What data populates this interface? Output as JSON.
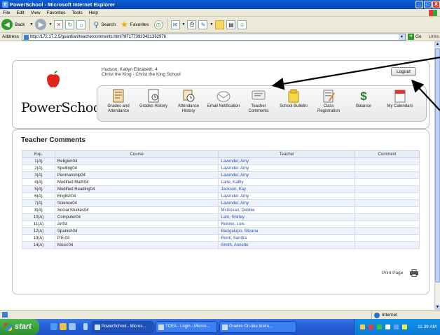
{
  "window": {
    "title": "PowerSchool - Microsoft Internet Explorer",
    "buttons": {
      "minimize": "_",
      "maximize": "□",
      "close": "X"
    }
  },
  "menu": [
    "File",
    "Edit",
    "View",
    "Favorites",
    "Tools",
    "Help"
  ],
  "toolbar": {
    "back": "Back",
    "search": "Search",
    "favorites": "Favorites"
  },
  "address": {
    "label": "Address",
    "url": "http://172.17.2.5/guardian/teachercomments.html?871773923421362976",
    "go": "Go",
    "links": "Links"
  },
  "header": {
    "logo": "PowerSchool",
    "student": "Hudson, Katlyn Elizabeth, 4",
    "school": "Christ the King - Christ the King School",
    "logout": "Logout"
  },
  "nav": [
    {
      "label": "Grades and Attendance",
      "icon": "grades-attendance-icon"
    },
    {
      "label": "Grades History",
      "icon": "grades-history-icon"
    },
    {
      "label": "Attendance History",
      "icon": "attendance-history-icon"
    },
    {
      "label": "Email Notification",
      "icon": "email-notification-icon"
    },
    {
      "label": "Teacher Comments",
      "icon": "teacher-comments-icon"
    },
    {
      "label": "School Bulletin",
      "icon": "school-bulletin-icon"
    },
    {
      "label": "Class Registration",
      "icon": "class-registration-icon"
    },
    {
      "label": "Balance",
      "icon": "balance-icon"
    },
    {
      "label": "My Calendars",
      "icon": "calendar-icon"
    }
  ],
  "content": {
    "title": "Teacher Comments",
    "columns": [
      "Exp.",
      "Course",
      "Teacher",
      "Comment"
    ],
    "rows": [
      {
        "exp": "1(A)",
        "course": "Religion04",
        "teacher": "Lavender, Amy",
        "comment": ""
      },
      {
        "exp": "2(A)",
        "course": "Spelling04",
        "teacher": "Lavender, Amy",
        "comment": ""
      },
      {
        "exp": "3(A)",
        "course": "Penmanship04",
        "teacher": "Lavender, Amy",
        "comment": ""
      },
      {
        "exp": "4(A)",
        "course": "Modified Math04",
        "teacher": "Lane, Kathy",
        "comment": ""
      },
      {
        "exp": "5(A)",
        "course": "Modified Reading04",
        "teacher": "Jackson, Kay",
        "comment": ""
      },
      {
        "exp": "6(A)",
        "course": "English04",
        "teacher": "Lavender, Amy",
        "comment": ""
      },
      {
        "exp": "7(A)",
        "course": "Science04",
        "teacher": "Lavender, Amy",
        "comment": ""
      },
      {
        "exp": "8(A)",
        "course": "Social Studies04",
        "teacher": "McGovan, Debbie",
        "comment": ""
      },
      {
        "exp": "10(A)",
        "course": "Computer04",
        "teacher": "Lam, Shirley",
        "comment": ""
      },
      {
        "exp": "11(A)",
        "course": "Art04",
        "teacher": "Rubino, Lois",
        "comment": ""
      },
      {
        "exp": "12(A)",
        "course": "Spanish04",
        "teacher": "Bacigalupo, Silvana",
        "comment": ""
      },
      {
        "exp": "13(A)",
        "course": "P.E.04",
        "teacher": "Ronk, Sandra",
        "comment": ""
      },
      {
        "exp": "14(A)",
        "course": "Music04",
        "teacher": "Smith, Annette",
        "comment": ""
      }
    ],
    "print": "Print Page"
  },
  "status": {
    "zone": "Internet"
  },
  "taskbar": {
    "start": "start",
    "tasks": [
      "PowerSchool - Micros...",
      "TCEA - Login - Micros...",
      "Grades On-line Instru..."
    ],
    "clock": "11:39 AM"
  },
  "colors": {
    "accent": "#245edb",
    "link": "#2a4fb0",
    "row_alt": "#eef2fa"
  }
}
